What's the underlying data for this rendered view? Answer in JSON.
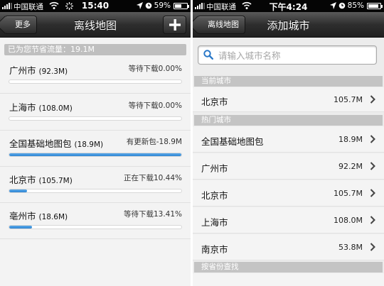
{
  "left": {
    "status": {
      "carrier": "中国联通",
      "time": "15:40",
      "battery": "59%",
      "battery_level": 0.59
    },
    "nav": {
      "back_label": "更多",
      "title": "离线地图",
      "add_icon": "plus-icon"
    },
    "savings_text": "已为您节省流量：19.1M",
    "items": [
      {
        "name": "广州市",
        "size": "(92.3M)",
        "status": "等待下载0.00%",
        "progress": 0.0
      },
      {
        "name": "上海市",
        "size": "(108.0M)",
        "status": "等待下载0.00%",
        "progress": 0.0
      },
      {
        "name": "全国基础地图包",
        "size": "(18.9M)",
        "status": "有更新包-18.9M",
        "progress": 1.0
      },
      {
        "name": "北京市",
        "size": "(105.7M)",
        "status": "正在下载10.44%",
        "progress": 0.1044
      },
      {
        "name": "亳州市",
        "size": "(18.6M)",
        "status": "等待下载13.41%",
        "progress": 0.1341
      }
    ]
  },
  "right": {
    "status": {
      "carrier": "中国联通",
      "time": "下午4:24",
      "battery": "85%",
      "battery_level": 0.85
    },
    "nav": {
      "back_label": "离线地图",
      "title": "添加城市"
    },
    "search": {
      "placeholder": "请输入城市名称"
    },
    "sections": {
      "current": "当前城市",
      "hot": "热门城市",
      "by_province": "按省份查找"
    },
    "current_city": {
      "name": "北京市",
      "size": "105.7M"
    },
    "hot_cities": [
      {
        "name": "全国基础地图包",
        "size": "18.9M"
      },
      {
        "name": "广州市",
        "size": "92.2M"
      },
      {
        "name": "北京市",
        "size": "105.7M"
      },
      {
        "name": "上海市",
        "size": "108.0M"
      },
      {
        "name": "南京市",
        "size": "53.8M"
      }
    ]
  }
}
